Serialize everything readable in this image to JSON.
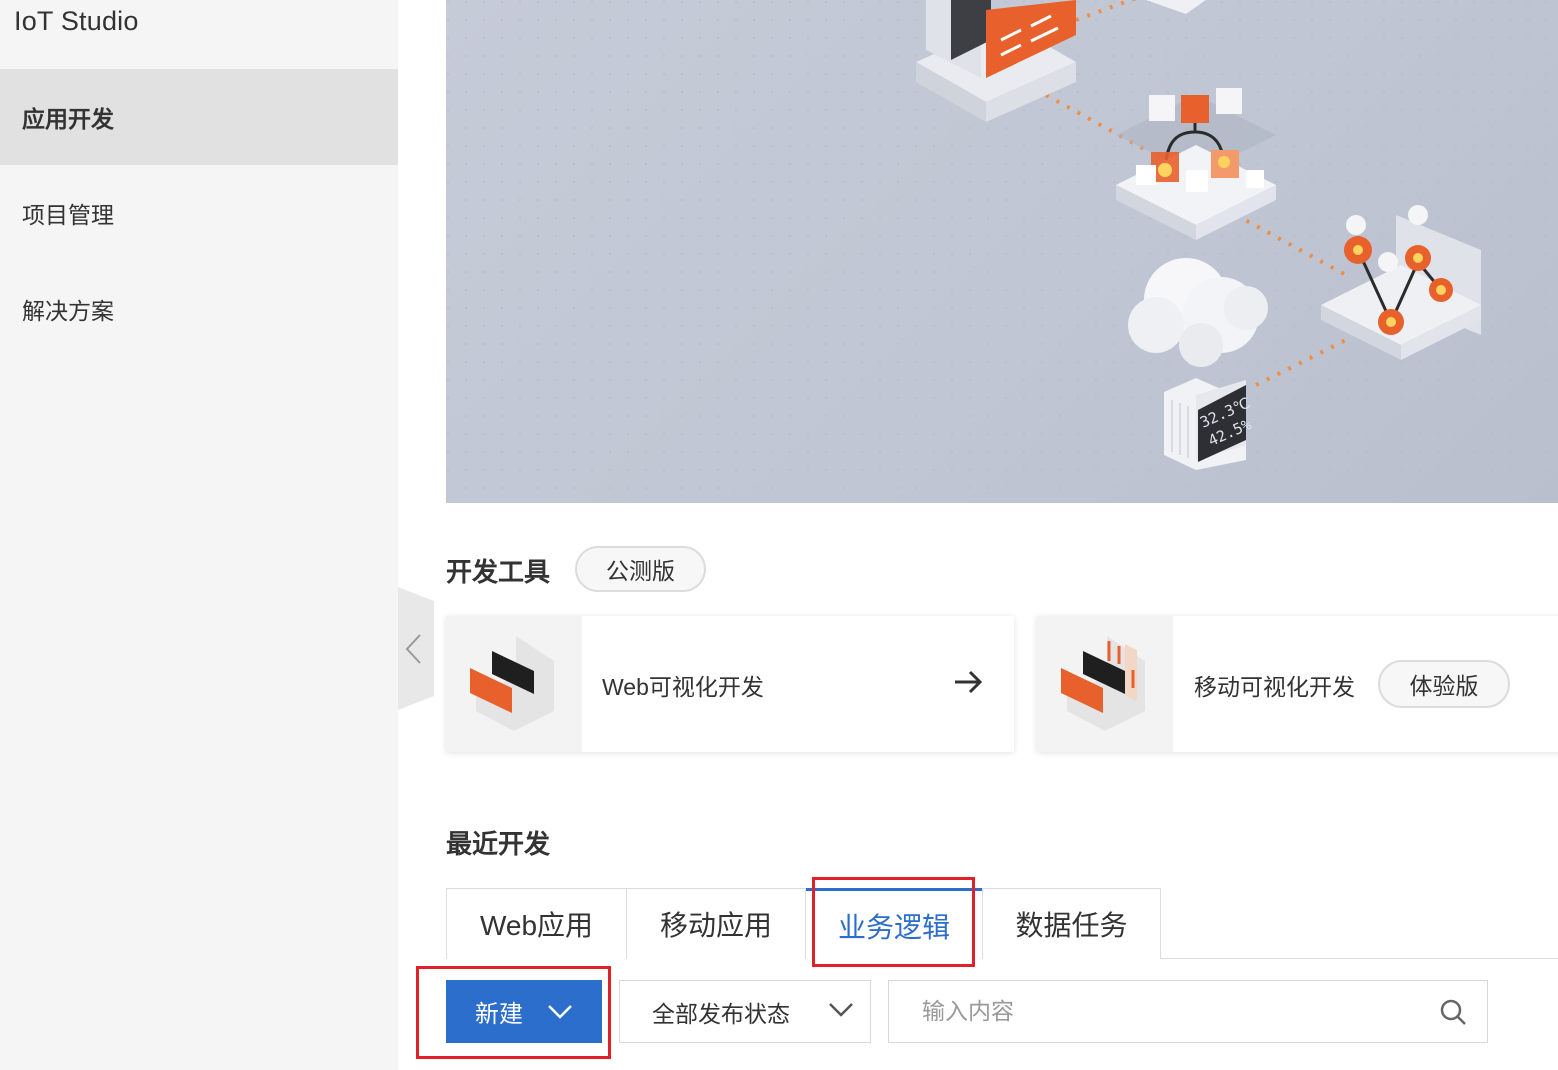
{
  "app": {
    "title": "IoT Studio"
  },
  "sidebar": {
    "items": [
      {
        "label": "应用开发",
        "active": true
      },
      {
        "label": "项目管理",
        "active": false
      },
      {
        "label": "解决方案",
        "active": false
      }
    ]
  },
  "banner": {
    "sensor_temp": "32.3℃",
    "sensor_humidity": "42.5%"
  },
  "dev_tools": {
    "title": "开发工具",
    "badge": "公测版",
    "cards": [
      {
        "label": "Web可视化开发",
        "icon": "arrow-right-icon"
      },
      {
        "label": "移动可视化开发",
        "badge": "体验版",
        "icon": "arrow-right-icon"
      }
    ]
  },
  "recent": {
    "title": "最近开发",
    "tabs": [
      {
        "label": "Web应用",
        "active": false
      },
      {
        "label": "移动应用",
        "active": false
      },
      {
        "label": "业务逻辑",
        "active": true
      },
      {
        "label": "数据任务",
        "active": false
      }
    ]
  },
  "toolbar": {
    "new_label": "新建",
    "status_select": "全部发布状态",
    "search_placeholder": "输入内容"
  },
  "colors": {
    "primary": "#2c6ecb",
    "highlight": "#e0202b",
    "accent_orange": "#e8612c"
  }
}
